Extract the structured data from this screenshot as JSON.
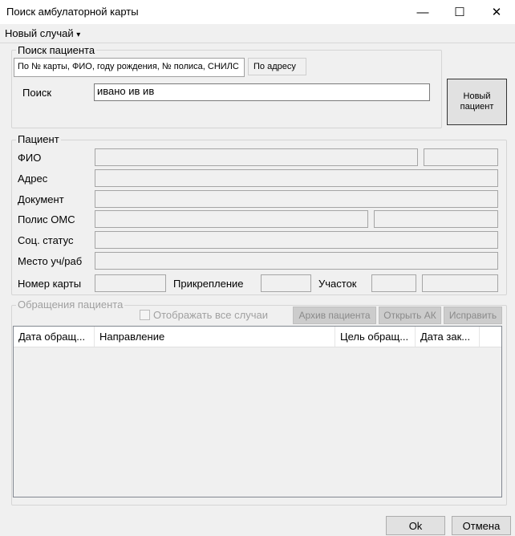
{
  "window": {
    "title": "Поиск амбулаторной карты",
    "minimize": "—",
    "maximize": "☐",
    "close": "✕"
  },
  "menu": {
    "new_case": "Новый случай",
    "arrow": "▾"
  },
  "search": {
    "group_title": "Поиск пациента",
    "tab_main": "По № карты, ФИО, году рождения, № полиса, СНИЛС",
    "tab_address": "По адресу",
    "label": "Поиск",
    "value": "ивано ив ив",
    "new_patient": "Новый пациент"
  },
  "patient": {
    "group_title": "Пациент",
    "fio": "ФИО",
    "address": "Адрес",
    "document": "Документ",
    "policy": "Полис ОМС",
    "social": "Соц. статус",
    "work": "Место уч/раб",
    "card_number": "Номер карты",
    "attachment": "Прикрепление",
    "district": "Участок"
  },
  "visits": {
    "group_title": "Обращения пациента",
    "show_all": "Отображать все случаи",
    "archive": "Архив пациента",
    "open_ak": "Открыть АК",
    "fix": "Исправить",
    "columns": [
      "Дата обращ...",
      "Направление",
      "Цель обращ...",
      "Дата зак..."
    ]
  },
  "footer": {
    "ok": "Ok",
    "cancel": "Отмена"
  }
}
